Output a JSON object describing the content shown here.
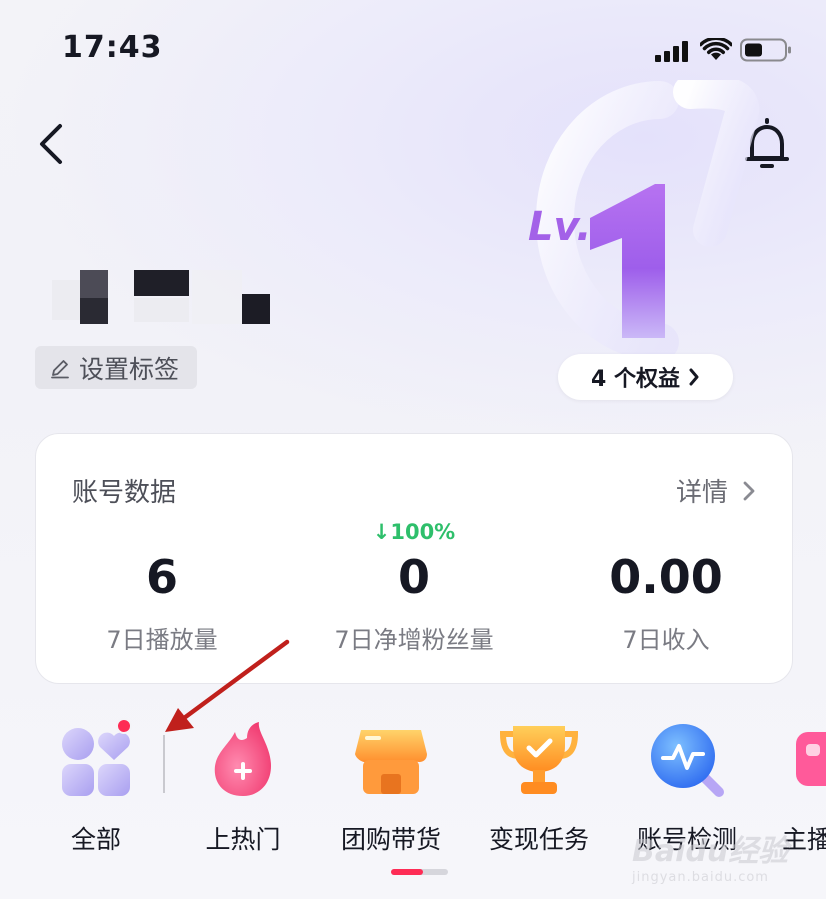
{
  "status_bar": {
    "time": "17:43"
  },
  "header": {
    "level_prefix": "Lv.",
    "level_number": "1"
  },
  "profile": {
    "tag_button_label": "设置标签",
    "perks_label": "4 个权益"
  },
  "account_card": {
    "title": "账号数据",
    "detail_label": "详情",
    "stats": [
      {
        "value": "6",
        "label": "7日播放量",
        "trend": ""
      },
      {
        "value": "0",
        "label": "7日净增粉丝量",
        "trend": "↓100%"
      },
      {
        "value": "0.00",
        "label": "7日收入",
        "trend": ""
      }
    ]
  },
  "shortcuts": [
    {
      "label": "全部",
      "icon": "all-grid-icon",
      "has_badge": true
    },
    {
      "label": "上热门",
      "icon": "hot-flame-icon"
    },
    {
      "label": "团购带货",
      "icon": "store-icon"
    },
    {
      "label": "变现任务",
      "icon": "trophy-icon"
    },
    {
      "label": "账号检测",
      "icon": "account-scan-icon"
    },
    {
      "label": "主播",
      "icon": "streamer-icon"
    }
  ],
  "watermark": {
    "main": "Baidu经验",
    "sub": "jingyan.baidu.com"
  },
  "colors": {
    "accent": "#fe2c55",
    "trend_green": "#2ebf6b",
    "annotation_arrow": "#c0201c"
  }
}
